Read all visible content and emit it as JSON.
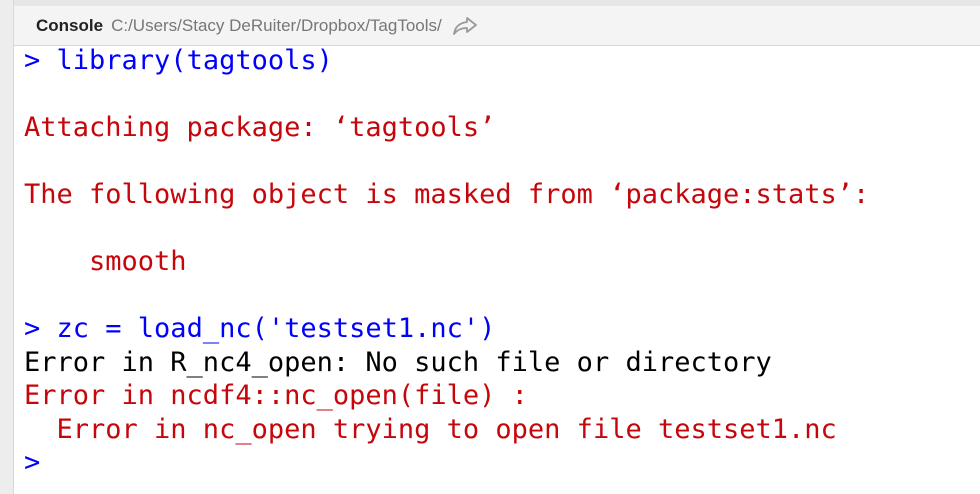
{
  "header": {
    "title": "Console",
    "path": "C:/Users/Stacy DeRuiter/Dropbox/TagTools/",
    "share_icon": "share-arrow-icon"
  },
  "console": {
    "prompt_symbol": ">",
    "lines": [
      {
        "kind": "command",
        "text": "library(tagtools)"
      },
      {
        "kind": "blank",
        "text": ""
      },
      {
        "kind": "error",
        "text": "Attaching package: ‘tagtools’"
      },
      {
        "kind": "blank",
        "text": ""
      },
      {
        "kind": "error",
        "text": "The following object is masked from ‘package:stats’:"
      },
      {
        "kind": "blank",
        "text": ""
      },
      {
        "kind": "error",
        "text": "    smooth"
      },
      {
        "kind": "blank",
        "text": ""
      },
      {
        "kind": "command",
        "text": "zc = load_nc('testset1.nc')"
      },
      {
        "kind": "output",
        "text": "Error in R_nc4_open: No such file or directory"
      },
      {
        "kind": "error",
        "text": "Error in ncdf4::nc_open(file) :"
      },
      {
        "kind": "error",
        "text": "  Error in nc_open trying to open file testset1.nc"
      },
      {
        "kind": "prompt",
        "text": ""
      }
    ]
  },
  "colors": {
    "command": "#0000ff",
    "error": "#c5060b",
    "output": "#000000"
  }
}
